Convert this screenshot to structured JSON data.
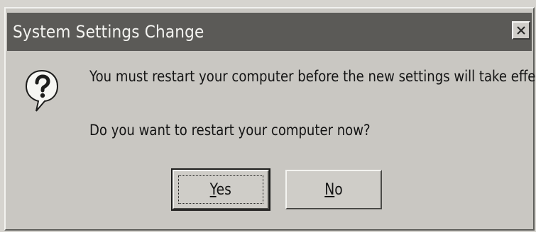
{
  "dialog": {
    "title": "System Settings Change",
    "close_icon": "close-icon",
    "icon": "question-mark-balloon-icon",
    "message": "You must restart your computer before the new settings will take effect.",
    "question": "Do you want to restart your computer now?",
    "buttons": {
      "yes": {
        "accel": "Y",
        "rest": "es"
      },
      "no": {
        "accel": "N",
        "rest": "o"
      }
    }
  }
}
